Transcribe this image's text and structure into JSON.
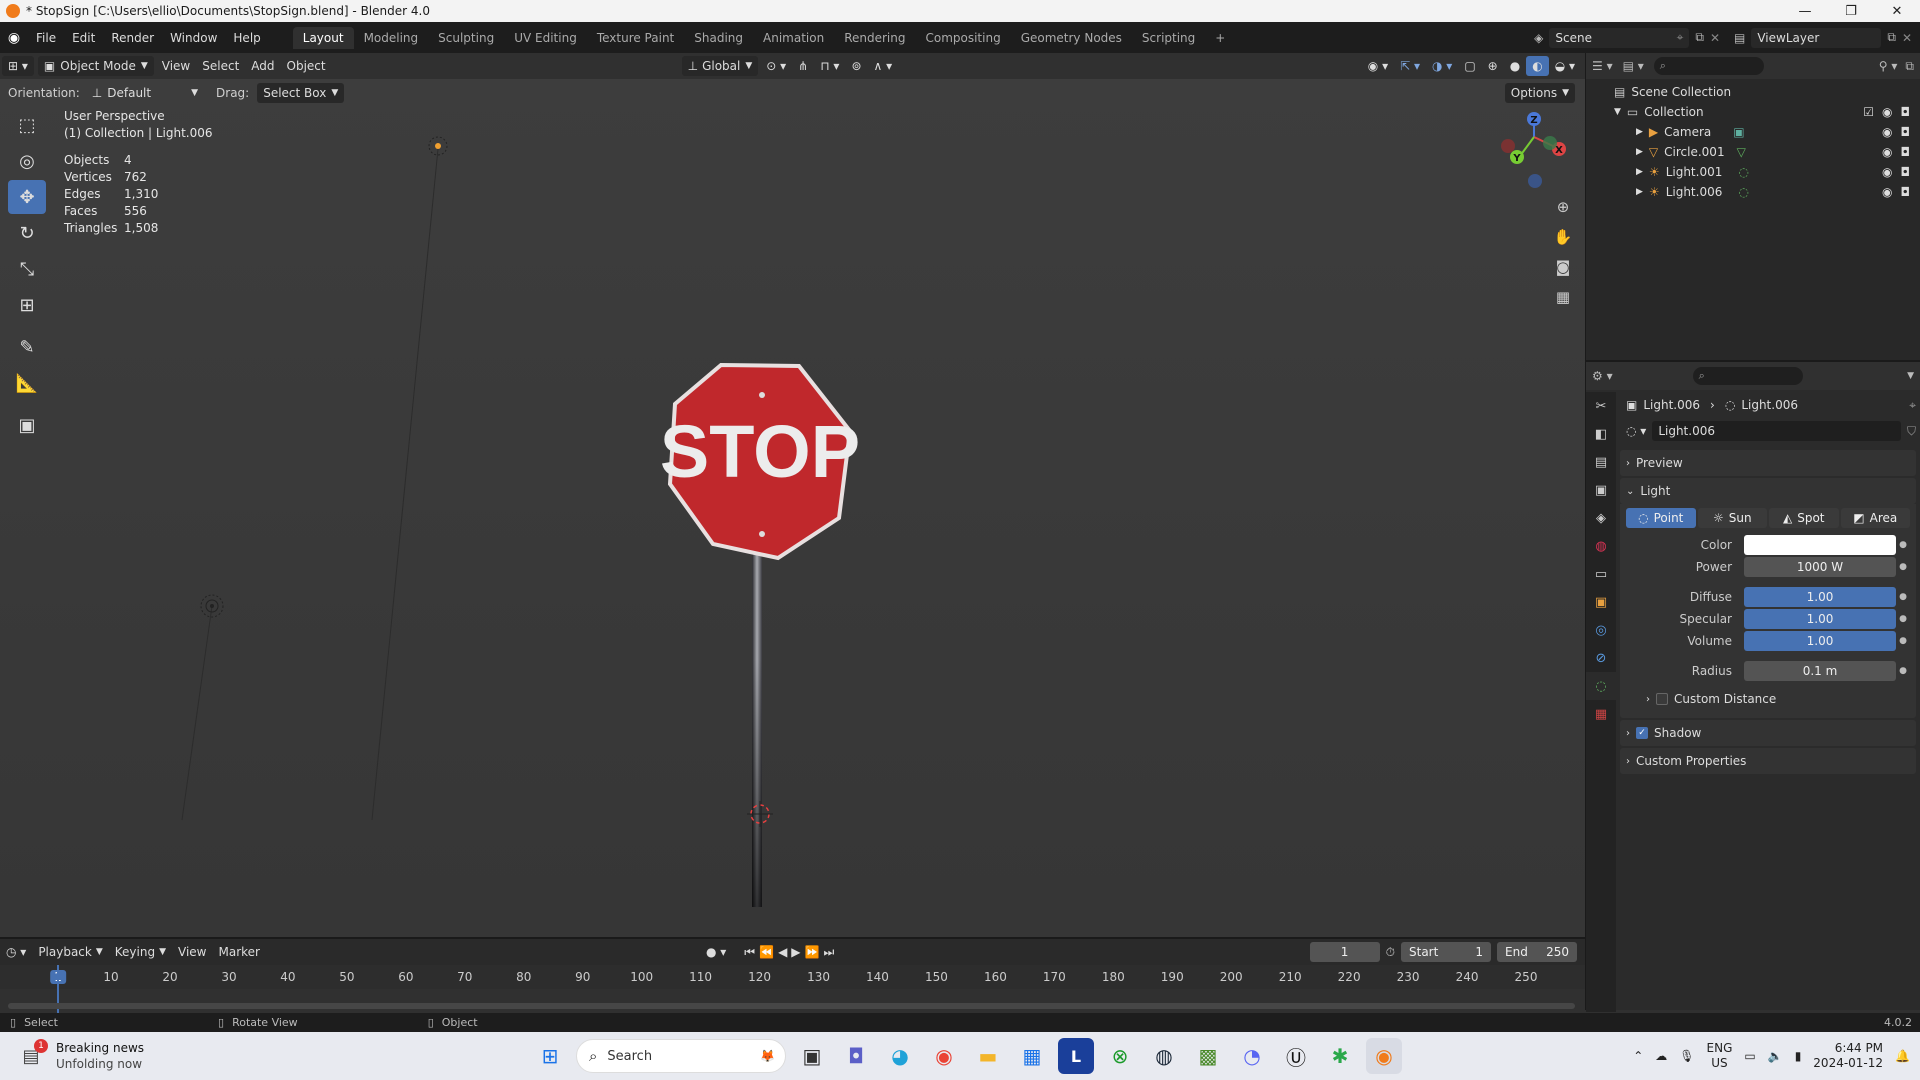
{
  "window": {
    "title": "* StopSign [C:\\Users\\ellio\\Documents\\StopSign.blend] - Blender 4.0",
    "controls": [
      "—",
      "❐",
      "✕"
    ]
  },
  "menu": [
    "File",
    "Edit",
    "Render",
    "Window",
    "Help"
  ],
  "workspaces": {
    "active": "Layout",
    "tabs": [
      "Layout",
      "Modeling",
      "Sculpting",
      "UV Editing",
      "Texture Paint",
      "Shading",
      "Animation",
      "Rendering",
      "Compositing",
      "Geometry Nodes",
      "Scripting"
    ],
    "add": "+"
  },
  "scene": {
    "name": "Scene",
    "view_layer": "ViewLayer"
  },
  "header3d": {
    "mode": "Object Mode",
    "menus": [
      "View",
      "Select",
      "Add",
      "Object"
    ],
    "transform_orientation": "Global",
    "options": "Options"
  },
  "tool_settings": {
    "orientation_label": "Orientation:",
    "orientation_value": "Default",
    "drag_label": "Drag:",
    "drag_value": "Select Box"
  },
  "viewport": {
    "perspective": "User Perspective",
    "collection_line": "(1) Collection | Light.006",
    "stats": [
      {
        "k": "Objects",
        "v": "4"
      },
      {
        "k": "Vertices",
        "v": "762"
      },
      {
        "k": "Edges",
        "v": "1,310"
      },
      {
        "k": "Faces",
        "v": "556"
      },
      {
        "k": "Triangles",
        "v": "1,508"
      }
    ],
    "sign_text": "STOP",
    "axes": {
      "x": "X",
      "y": "Y",
      "z": "Z"
    }
  },
  "outliner": {
    "root": "Scene Collection",
    "collection": "Collection",
    "items": [
      "Camera",
      "Circle.001",
      "Light.001",
      "Light.006"
    ]
  },
  "properties": {
    "breadcrumb_object": "Light.006",
    "breadcrumb_data": "Light.006",
    "datablock": "Light.006",
    "panels": {
      "preview": "Preview",
      "light": "Light",
      "custom_distance": "Custom Distance",
      "shadow": "Shadow",
      "custom_properties": "Custom Properties"
    },
    "light_types": [
      "Point",
      "Sun",
      "Spot",
      "Area"
    ],
    "active_type": "Point",
    "fields": {
      "color_label": "Color",
      "power_label": "Power",
      "power": "1000 W",
      "diffuse_label": "Diffuse",
      "diffuse": "1.00",
      "specular_label": "Specular",
      "specular": "1.00",
      "volume_label": "Volume",
      "volume": "1.00",
      "radius_label": "Radius",
      "radius": "0.1 m"
    },
    "shadow_checked": true,
    "custom_distance_checked": false,
    "color_value": "#ffffff"
  },
  "timeline": {
    "menus": [
      "Playback",
      "Keying",
      "View",
      "Marker"
    ],
    "current_frame": "1",
    "start_label": "Start",
    "start": "1",
    "end_label": "End",
    "end": "250",
    "ruler": [
      "1",
      "10",
      "20",
      "30",
      "40",
      "50",
      "60",
      "70",
      "80",
      "90",
      "100",
      "110",
      "120",
      "130",
      "140",
      "150",
      "160",
      "170",
      "180",
      "190",
      "200",
      "210",
      "220",
      "230",
      "240",
      "250"
    ]
  },
  "statusbar": {
    "select": "Select",
    "rotate": "Rotate View",
    "object": "Object",
    "version": "4.0.2"
  },
  "taskbar": {
    "news_title": "Breaking news",
    "news_sub": "Unfolding now",
    "news_badge": "1",
    "search": "Search",
    "lang1": "ENG",
    "lang2": "US",
    "time": "6:44 PM",
    "date": "2024-01-12"
  },
  "colors": {
    "accent": "#4772b3",
    "sign_red": "#c0282c",
    "active_tab": "#303030"
  }
}
